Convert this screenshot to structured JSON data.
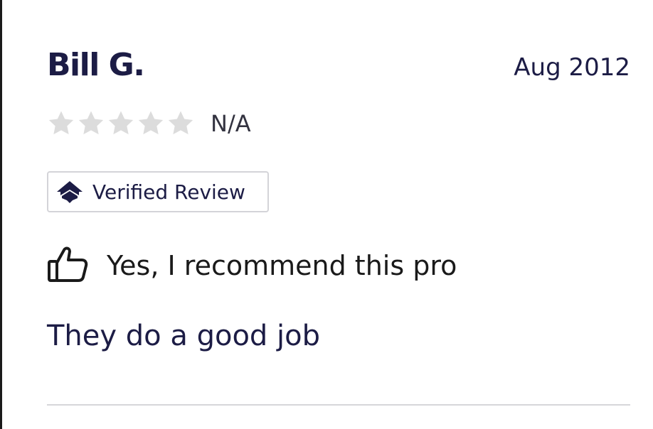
{
  "review": {
    "reviewer_name": "Bill G.",
    "date": "Aug 2012",
    "rating": {
      "stars_filled": 0,
      "stars_total": 5,
      "text": "N/A",
      "empty_star_color": "#dcdcdc"
    },
    "badge": {
      "icon": "house-roof-icon",
      "label": "Verified Review"
    },
    "recommendation": {
      "icon": "thumbs-up-icon",
      "text": "Yes, I recommend this pro"
    },
    "body": "They do a good job"
  },
  "colors": {
    "text_primary": "#1c1c45",
    "border": "#d4d4d8",
    "divider": "#d6d6da"
  }
}
